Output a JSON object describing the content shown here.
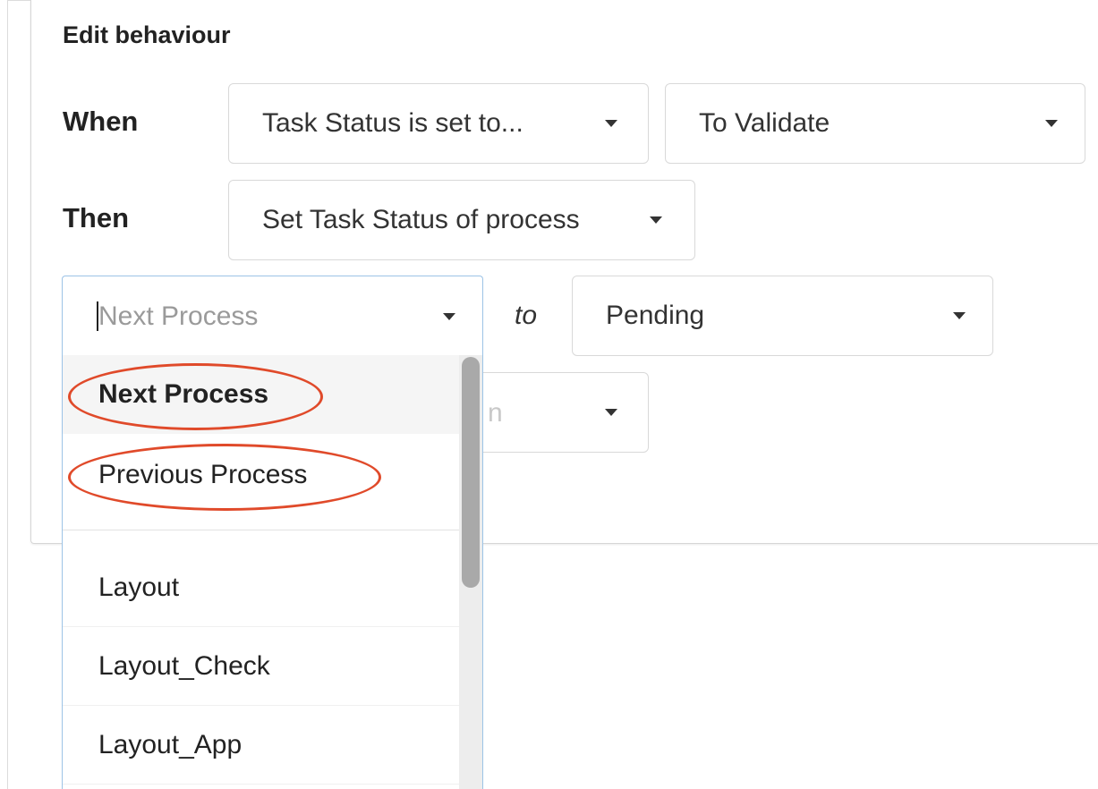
{
  "panel": {
    "title": "Edit behaviour"
  },
  "rule": {
    "when_label": "When",
    "then_label": "Then",
    "trigger_select": "Task Status is set to...",
    "trigger_value_select": "To Validate",
    "action_select": "Set Task Status of process",
    "target_input": {
      "placeholder": "Next Process"
    },
    "to_label": "to",
    "status_select": "Pending",
    "obscured_select_fragment": "n"
  },
  "dropdown": {
    "options_top": [
      "Next Process",
      "Previous Process"
    ],
    "options_list": [
      "Layout",
      "Layout_Check",
      "Layout_App"
    ],
    "highlighted": "Next Process"
  },
  "colors": {
    "annotation": "#e04a2a",
    "focus_border": "#9cc3e6"
  }
}
